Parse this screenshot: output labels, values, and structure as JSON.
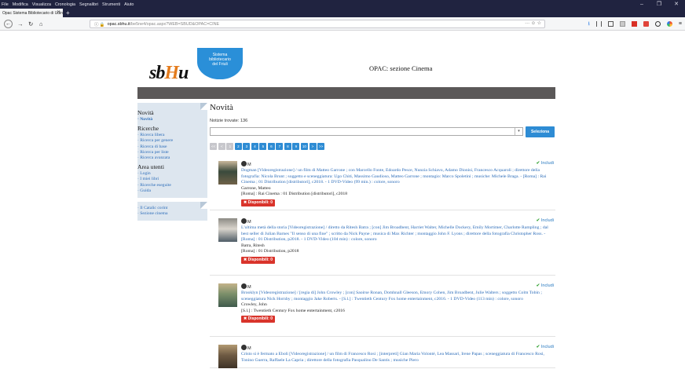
{
  "browser": {
    "menu": [
      "File",
      "Modifica",
      "Visualizza",
      "Cronologia",
      "Segnalibri",
      "Strumenti",
      "Aiuto"
    ],
    "tab_title": "Opac Sistema Bibliotecario di Udin",
    "url_host": "opac.sbhu.it",
    "url_rest": "/be5ne4/opac.aspx?WEB=SBUD&OPAC=CINE",
    "url_page_actions": "··· ☺ ☆"
  },
  "logo": {
    "bubble_lines": [
      "Sistema",
      "bibliotecario",
      "del Friuli"
    ]
  },
  "site_title": "OPAC: sezione Cinema",
  "sidebar": {
    "box1": {
      "sections": [
        {
          "title": "Novità",
          "items": [
            {
              "label": "Novità",
              "current": true
            }
          ]
        },
        {
          "title": "Ricerche",
          "items": [
            {
              "label": "Ricerca libera"
            },
            {
              "label": "Ricerca per genere"
            },
            {
              "label": "Ricerca di base"
            },
            {
              "label": "Ricerca per liste"
            },
            {
              "label": "Ricerca avanzata"
            }
          ]
        },
        {
          "title": "Area utenti",
          "items": [
            {
              "label": "Login"
            },
            {
              "label": "I miei libri"
            },
            {
              "label": "Ricerche eseguite"
            },
            {
              "label": "Guida"
            }
          ]
        }
      ]
    },
    "box2": {
      "items": [
        {
          "label": "Il Catalic corint"
        },
        {
          "label": "Sezione cinema"
        }
      ]
    }
  },
  "main": {
    "heading": "Novità",
    "found": "Notizie trovate: 136",
    "select_label": "Seleziona",
    "pager": [
      {
        "label": "<<",
        "disabled": true
      },
      {
        "label": "<",
        "disabled": true
      },
      {
        "label": "1",
        "disabled": true
      },
      {
        "label": "2"
      },
      {
        "label": "3"
      },
      {
        "label": "4"
      },
      {
        "label": "5"
      },
      {
        "label": "6"
      },
      {
        "label": "7"
      },
      {
        "label": "8"
      },
      {
        "label": "9"
      },
      {
        "label": "10"
      },
      {
        "label": ">"
      },
      {
        "label": ">>"
      }
    ],
    "records": [
      {
        "material": "M",
        "include": "Includi",
        "title": "Dogman [Videoregistrazione] / un film di Matteo Garrone ; con Marcello Fonte, Edoardo Pesce, Nunzia Schiavo, Adamo Dionisi, Francesco Acquaroli ; direttore della fotografia: Nicola Brunt ; soggetto e sceneggiatura: Ugo Chiti, Massimo Gaudioso, Matteo Garrone ; montagio: Marco Spoletini ; musiche: Michele Braga. - [Roma] : Rai Cinema ; 01 Distribution [distributori], c2018. - 1 DVD-Video (99 min.) : colore, sonoro",
        "author": "Garrone, Matteo",
        "pub": "[Roma] : Rai Cinema : 01 Distribution [distributori], c2018",
        "avail": "Disponibili: 0",
        "thumb_colors": [
          "#3a4a3c",
          "#c9b79a",
          "#6f6148"
        ]
      },
      {
        "material": "M",
        "include": "Includi",
        "title": "L'ultima metà della storia [Videoregistrazione] / diretto da Ritesh Batra ; [con] Jim Broadbent, Harriet Walter, Michelle Dockery, Emily Mortimer, Charlotte Rampling ; dal best seller di Julian Barnes \"Il senso di una fine\" ; scritto da Nick Payne ; musica di Max Richter ; montaggio John F. Lyons ; direttore della fotografia Christopher Ross. - [Roma] : 01 Distribution, p2018. - 1 DVD-Video (104 min) : colore, sonoro",
        "author": "Batra, Ritesh",
        "pub": "[Roma] : 01 Distribution, p2018",
        "avail": "Disponibili: 0",
        "thumb_colors": [
          "#d9d4cc",
          "#8c8a84",
          "#4f5c66"
        ]
      },
      {
        "material": "M",
        "include": "Includi",
        "title": "Brooklyn [Videoregistrazione] / [regia di] John Crowley ; [con] Saoirse Ronan, Domhnall Gleeson, Emory Cohen, Jim Broadbent, Julie Walters ; soggetto Colm Tobin ; sceneggiatura Nick Hornby ; montaggio Jake Roberts. - [S.l.] : Twentieth Century Fox home entertainment, c2016. - 1 DVD-Video (113 min) : colore, sonoro",
        "author": "Crowley, John",
        "pub": "[S.l.] : Twentieth Century Fox home entertainment, c2016",
        "avail": "Disponibili: 0",
        "thumb_colors": [
          "#7b8f6a",
          "#c4b38a",
          "#3f5a4c"
        ]
      },
      {
        "material": "M",
        "include": "Includi",
        "title": "Cristo si è fermato a Eboli [Videoregistrazione] / un film di Francesco Rosi ; [interpreti] Gian Maria Volonté, Lea Massari, Irene Papas ; sceneggiatura di Francesco Rosi, Tonino Guerra, Raffaele La Capria ; direttore della fotografia Pasqualino De Santis ; musiche Piero",
        "author": "",
        "pub": "",
        "avail": "",
        "thumb_colors": [
          "#6e5a43",
          "#b39a72",
          "#3e3226"
        ]
      }
    ]
  }
}
